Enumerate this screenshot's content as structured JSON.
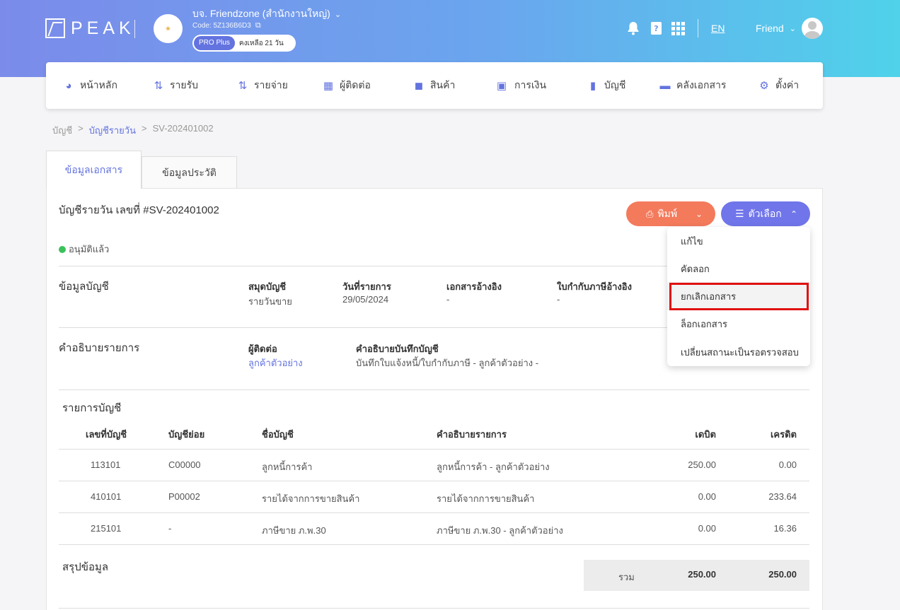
{
  "header": {
    "logo_text": "PEAK",
    "company_name": "บจ. Friendzone (สำนักงานใหญ่)",
    "company_code": "Code: 5Z136B6D3",
    "plan_badge": "PRO Plus",
    "plan_remaining": "คงเหลือ 21 วัน",
    "lang": "EN",
    "user_name": "Friend"
  },
  "nav": {
    "items": [
      {
        "label": "หน้าหลัก",
        "icon": "dashboard-icon"
      },
      {
        "label": "รายรับ",
        "icon": "income-icon"
      },
      {
        "label": "รายจ่าย",
        "icon": "expense-icon"
      },
      {
        "label": "ผู้ติดต่อ",
        "icon": "contacts-icon"
      },
      {
        "label": "สินค้า",
        "icon": "product-box-icon"
      },
      {
        "label": "การเงิน",
        "icon": "money-icon"
      },
      {
        "label": "บัญชี",
        "icon": "book-icon"
      },
      {
        "label": "คลังเอกสาร",
        "icon": "folder-icon"
      },
      {
        "label": "ตั้งค่า",
        "icon": "gear-icon"
      }
    ]
  },
  "breadcrumb": {
    "root": "บัญชี",
    "sep1": ">",
    "parent": "บัญชีรายวัน",
    "sep2": ">",
    "current": "SV-202401002"
  },
  "tabs": {
    "doc_info": "ข้อมูลเอกสาร",
    "history": "ข้อมูลประวัติ"
  },
  "document": {
    "title": "บัญชีรายวัน เลขที่ #SV-202401002",
    "status": "อนุมัติแล้ว",
    "print_label": "พิมพ์",
    "options_label": "ตัวเลือก"
  },
  "account_info": {
    "section_title": "ข้อมูลบัญชี",
    "journal_label": "สมุดบัญชี",
    "journal_value": "รายวันขาย",
    "date_label": "วันที่รายการ",
    "date_value": "29/05/2024",
    "ref_doc_label": "เอกสารอ้างอิง",
    "ref_doc_value": "-",
    "tax_ref_label": "ใบกำกับภาษีอ้างอิง",
    "tax_ref_value": "-"
  },
  "description": {
    "section_title": "คำอธิบายรายการ",
    "contact_label": "ผู้ติดต่อ",
    "contact_value": "ลูกค้าตัวอย่าง",
    "memo_label": "คำอธิบายบันทึกบัญชี",
    "memo_value": "บันทึกใบแจ้งหนี้/ใบกำกับภาษี - ลูกค้าตัวอย่าง -"
  },
  "ledger": {
    "section_title": "รายการบัญชี",
    "headers": {
      "account_no": "เลขที่บัญชี",
      "sub_account": "บัญชีย่อย",
      "account_name": "ชื่อบัญชี",
      "description": "คำอธิบายรายการ",
      "debit": "เดบิต",
      "credit": "เครดิต"
    },
    "rows": [
      {
        "account_no": "113101",
        "sub_account": "C00000",
        "account_name": "ลูกหนี้การค้า",
        "description": "ลูกหนี้การค้า - ลูกค้าตัวอย่าง",
        "debit": "250.00",
        "credit": "0.00"
      },
      {
        "account_no": "410101",
        "sub_account": "P00002",
        "account_name": "รายได้จากการขายสินค้า",
        "description": "รายได้จากการขายสินค้า",
        "debit": "0.00",
        "credit": "233.64"
      },
      {
        "account_no": "215101",
        "sub_account": "-",
        "account_name": "ภาษีขาย ภ.พ.30",
        "description": "ภาษีขาย ภ.พ.30 - ลูกค้าตัวอย่าง",
        "debit": "0.00",
        "credit": "16.36"
      }
    ]
  },
  "summary": {
    "section_title": "สรุปข้อมูล",
    "total_label": "รวม",
    "total_debit": "250.00",
    "total_credit": "250.00"
  },
  "options_menu": {
    "items": [
      "แก้ไข",
      "คัดลอก",
      "ยกเลิกเอกสาร",
      "ล็อกเอกสาร",
      "เปลี่ยนสถานะเป็นรอตรวจสอบ"
    ],
    "highlighted_item": "ยกเลิกเอกสาร",
    "highlight_color": "#e01010"
  },
  "colors": {
    "accent": "#6373df",
    "print_button": "#f47a5c",
    "options_button": "#7075ea",
    "status_approved": "#3cc15a"
  }
}
